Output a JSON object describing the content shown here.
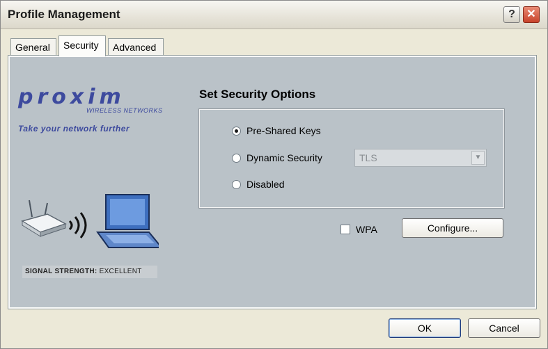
{
  "window": {
    "title": "Profile Management"
  },
  "titlebar_buttons": {
    "help": "?",
    "close": "✕"
  },
  "tabs": [
    {
      "label": "General",
      "active": false
    },
    {
      "label": "Security",
      "active": true
    },
    {
      "label": "Advanced",
      "active": false
    }
  ],
  "branding": {
    "logo_text": "proxim",
    "logo_subtitle": "WIRELESS NETWORKS",
    "tagline": "Take your network further",
    "signal_label": "SIGNAL STRENGTH:",
    "signal_value": "EXCELLENT"
  },
  "security": {
    "group_title": "Set Security Options",
    "options": [
      {
        "label": "Pre-Shared Keys",
        "selected": true
      },
      {
        "label": "Dynamic Security",
        "selected": false
      },
      {
        "label": "Disabled",
        "selected": false
      }
    ],
    "dynamic_select_value": "TLS",
    "wpa_label": "WPA",
    "wpa_checked": false,
    "configure_label": "Configure..."
  },
  "footer": {
    "ok_label": "OK",
    "cancel_label": "Cancel"
  },
  "colors": {
    "panel_bg": "#bac2c8",
    "brand": "#3d4a9e"
  }
}
